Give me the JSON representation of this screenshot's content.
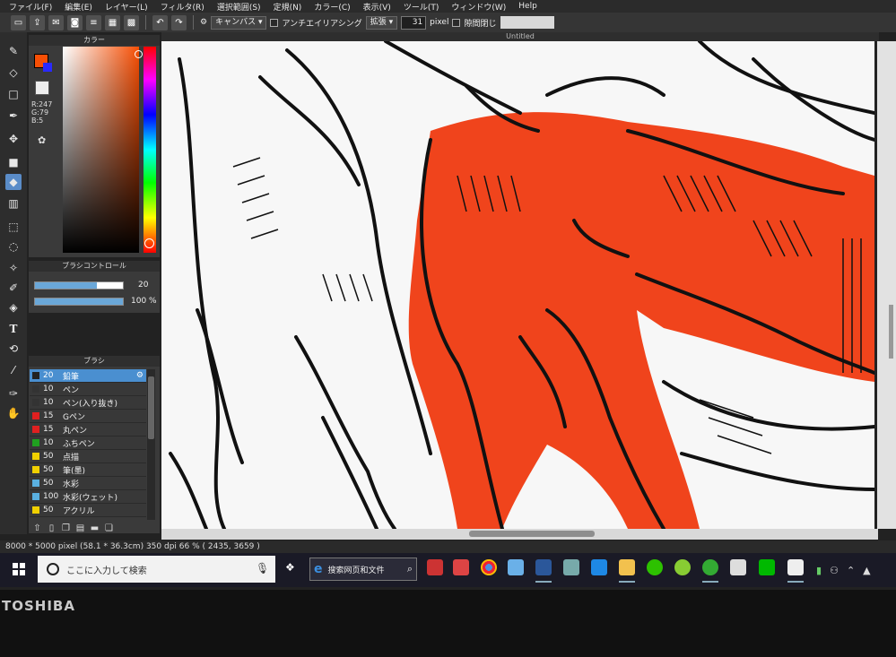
{
  "menu": [
    "ファイル(F)",
    "編集(E)",
    "レイヤー(L)",
    "フィルタ(R)",
    "選択範囲(S)",
    "定規(N)",
    "カラー(C)",
    "表示(V)",
    "ツール(T)",
    "ウィンドウ(W)",
    "Help"
  ],
  "toolbar": {
    "target_label": "キャンバス",
    "antialias_label": "アンチエイリアシング",
    "mode_label": "拡張",
    "size_value": "31",
    "size_unit": "pixel",
    "gap_label": "隙間閉じ"
  },
  "canvas_title": "Untitled",
  "color_panel": {
    "title": "カラー",
    "r": "R:247",
    "g": "G:79",
    "b": "B:5",
    "main_color": "#f74f05"
  },
  "brush_control": {
    "title": "ブラシコントロール",
    "size_value": "20",
    "opacity_value": "100 %",
    "size_fraction": 0.7,
    "opacity_fraction": 1.0
  },
  "brush_panel": {
    "title": "ブラシ",
    "items": [
      {
        "size": "20",
        "name": "鉛筆",
        "color": "#222222",
        "active": true
      },
      {
        "size": "10",
        "name": "ペン",
        "color": "#333333"
      },
      {
        "size": "10",
        "name": "ペン(入り抜き)",
        "color": "#333333"
      },
      {
        "size": "15",
        "name": "Gペン",
        "color": "#e02020"
      },
      {
        "size": "15",
        "name": "丸ペン",
        "color": "#e02020"
      },
      {
        "size": "10",
        "name": "ふちペン",
        "color": "#20a020"
      },
      {
        "size": "50",
        "name": "点描",
        "color": "#f0d000"
      },
      {
        "size": "50",
        "name": "筆(墨)",
        "color": "#f0d000"
      },
      {
        "size": "50",
        "name": "水彩",
        "color": "#5ab0e0"
      },
      {
        "size": "100",
        "name": "水彩(ウェット)",
        "color": "#5ab0e0"
      },
      {
        "size": "50",
        "name": "アクリル",
        "color": "#f0d000"
      }
    ]
  },
  "status": "8000 * 5000 pixel   (58.1 * 36.3cm)   350 dpi   66 %   ( 2435, 3659 )",
  "taskbar": {
    "search_placeholder": "ここに入力して検索",
    "edge_search": "搜索网页和文件"
  },
  "brand": "TOSHIBA",
  "icons": {
    "tools": [
      "brush-icon",
      "eraser-icon",
      "square-icon",
      "pen-icon",
      "move-icon",
      "fill-square-icon",
      "bucket-icon",
      "gradient-icon",
      "select-rect-icon",
      "lasso-icon",
      "magic-wand-icon",
      "select-pen-icon",
      "select-eraser-icon",
      "text-icon",
      "transform-icon",
      "picker-icon",
      "dropper-icon",
      "hand-icon"
    ]
  }
}
